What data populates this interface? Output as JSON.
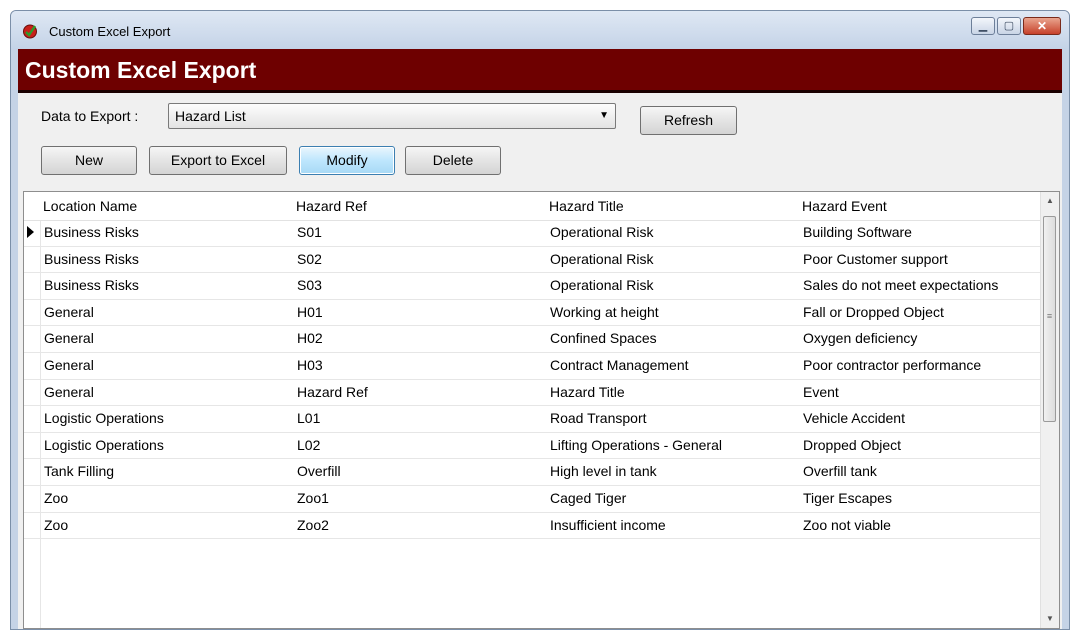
{
  "window": {
    "title": "Custom Excel Export",
    "minimize_glyph": "▁",
    "maximize_glyph": "▢",
    "close_glyph": "✕"
  },
  "banner": {
    "title": "Custom Excel Export"
  },
  "toolbar": {
    "data_to_export_label": "Data to Export :",
    "data_to_export_value": "Hazard List",
    "refresh_label": "Refresh",
    "new_label": "New",
    "export_label": "Export to Excel",
    "modify_label": "Modify",
    "delete_label": "Delete"
  },
  "grid": {
    "columns": [
      "Location Name",
      "Hazard Ref",
      "Hazard Title",
      "Hazard Event"
    ],
    "rows": [
      [
        "Business Risks",
        "S01",
        "Operational Risk",
        "Building Software"
      ],
      [
        "Business Risks",
        "S02",
        "Operational Risk",
        "Poor Customer support"
      ],
      [
        "Business Risks",
        "S03",
        "Operational Risk",
        "Sales do not meet expectations"
      ],
      [
        "General",
        "H01",
        "Working at height",
        "Fall or Dropped Object"
      ],
      [
        "General",
        "H02",
        "Confined Spaces",
        "Oxygen deficiency"
      ],
      [
        "General",
        "H03",
        "Contract Management",
        "Poor contractor performance"
      ],
      [
        "General",
        "Hazard Ref",
        "Hazard Title",
        "Event"
      ],
      [
        "Logistic Operations",
        "L01",
        "Road Transport",
        "Vehicle Accident"
      ],
      [
        "Logistic Operations",
        "L02",
        "Lifting Operations - General",
        "Dropped Object"
      ],
      [
        "Tank Filling",
        "Overfill",
        "High level in tank",
        "Overfill tank"
      ],
      [
        "Zoo",
        "Zoo1",
        "Caged Tiger",
        "Tiger Escapes"
      ],
      [
        "Zoo",
        "Zoo2",
        "Insufficient income",
        "Zoo not viable"
      ]
    ]
  },
  "colors": {
    "banner": "#6e0000",
    "focus_button": "#bee6fd"
  },
  "icons": {
    "app": "app-logo-icon",
    "scroll_up": "scroll-up-arrow-icon",
    "scroll_down": "scroll-down-arrow-icon"
  }
}
